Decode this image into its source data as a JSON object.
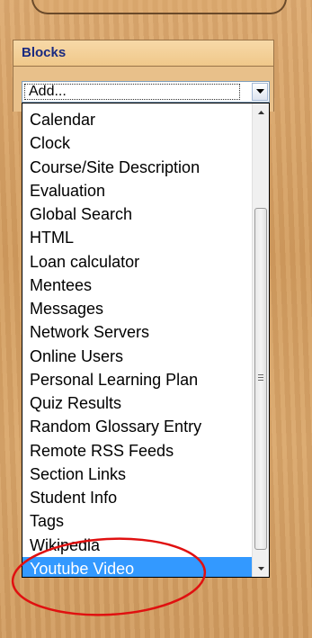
{
  "block": {
    "title": "Blocks"
  },
  "select": {
    "value": "Add..."
  },
  "dropdown": {
    "items": [
      "Calendar",
      "Clock",
      "Course/Site Description",
      "Evaluation",
      "Global Search",
      "HTML",
      "Loan calculator",
      "Mentees",
      "Messages",
      "Network Servers",
      "Online Users",
      "Personal Learning Plan",
      "Quiz Results",
      "Random Glossary Entry",
      "Remote RSS Feeds",
      "Section Links",
      "Student Info",
      "Tags",
      "Wikipedia",
      "Youtube Video"
    ],
    "selected_index": 19
  },
  "colors": {
    "header_text": "#1a2a80",
    "selection": "#3399ff",
    "annotation": "#e01010"
  },
  "icons": {
    "select_arrow": "chevron-down-icon",
    "scroll_up": "scroll-up-arrow-icon",
    "scroll_down": "scroll-down-arrow-icon"
  }
}
